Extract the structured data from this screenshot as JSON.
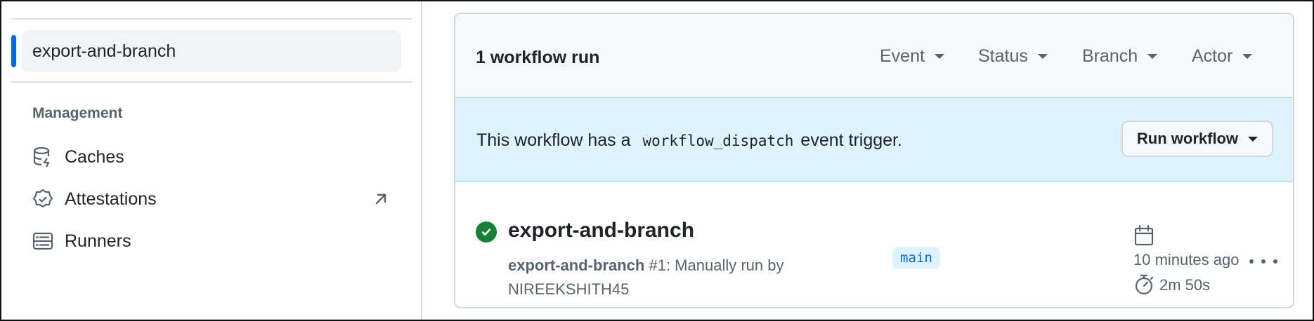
{
  "sidebar": {
    "selected_workflow": "export-and-branch",
    "group_label": "Management",
    "items": [
      {
        "label": "Caches",
        "icon": "database-icon"
      },
      {
        "label": "Attestations",
        "icon": "verified-badge-icon",
        "external": true
      },
      {
        "label": "Runners",
        "icon": "server-icon"
      }
    ]
  },
  "runs_header": {
    "count_label": "1 workflow run",
    "filters": [
      "Event",
      "Status",
      "Branch",
      "Actor"
    ]
  },
  "banner": {
    "prefix": "This workflow has a",
    "code": "workflow_dispatch",
    "suffix": "event trigger.",
    "button_label": "Run workflow"
  },
  "run": {
    "title": "export-and-branch",
    "meta_workflow": "export-and-branch",
    "meta_text": "#1: Manually run by",
    "actor": "NIREEKSHITH45",
    "branch": "main",
    "time_ago": "10 minutes ago",
    "duration": "2m 50s",
    "status": "success"
  },
  "colors": {
    "accent": "#0969da",
    "success": "#1a7f37",
    "banner_bg": "#ddf4ff"
  }
}
